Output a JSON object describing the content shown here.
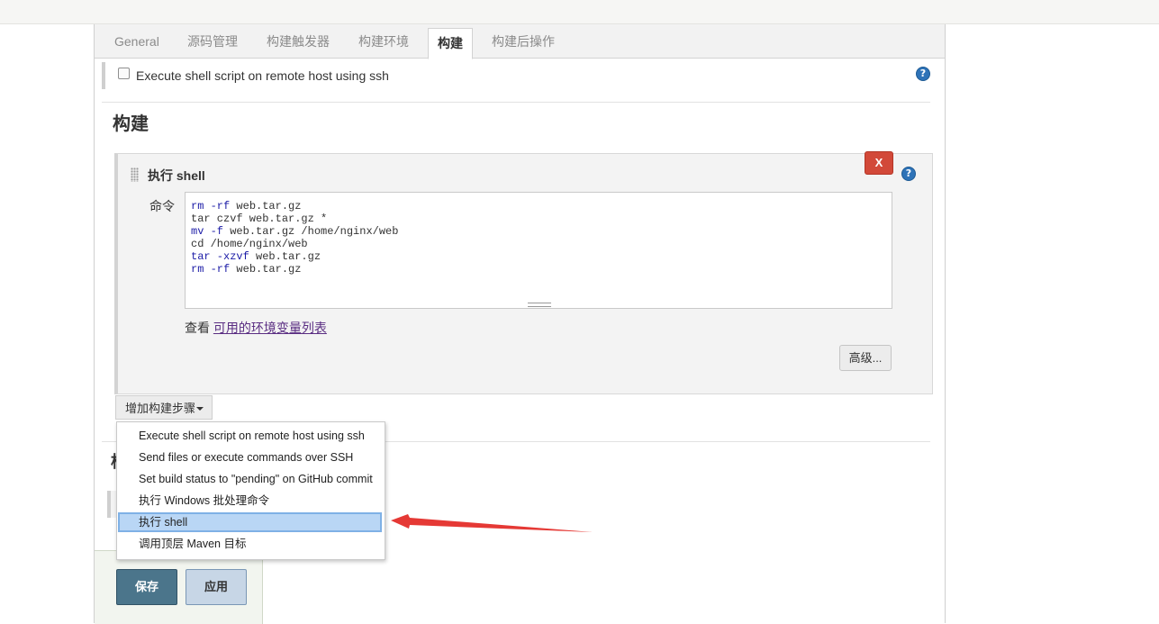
{
  "tabs": [
    "General",
    "源码管理",
    "构建触发器",
    "构建环境",
    "构建",
    "构建后操作"
  ],
  "ssh_option": {
    "label": "Execute shell script on remote host using ssh",
    "checked": false
  },
  "section_title": "构建",
  "build_step": {
    "title": "执行 shell",
    "delete_label": "X",
    "command_label": "命令",
    "command_lines": [
      {
        "kw": "rm -rf",
        "rest": " web.tar.gz"
      },
      {
        "kw": "",
        "rest": "tar czvf web.tar.gz *"
      },
      {
        "kw": "mv -f",
        "rest": " web.tar.gz /home/nginx/web"
      },
      {
        "kw": "",
        "rest": "cd /home/nginx/web"
      },
      {
        "kw": "tar -xzvf",
        "rest": " web.tar.gz"
      },
      {
        "kw": "rm -rf",
        "rest": " web.tar.gz"
      }
    ],
    "see_prefix": "查看 ",
    "see_link": "可用的环境变量列表",
    "advanced_label": "高级..."
  },
  "add_step_label": "增加构建步骤",
  "hidden_section_title": "构",
  "dropdown": {
    "items": [
      "Execute shell script on remote host using ssh",
      "Send files or execute commands over SSH",
      "Set build status to \"pending\" on GitHub commit",
      "执行 Windows 批处理命令",
      "执行 shell",
      "调用顶层 Maven 目标"
    ],
    "selected_index": 4
  },
  "buttons": {
    "save": "保存",
    "apply": "应用"
  },
  "help_glyph": "?",
  "colors": {
    "delete": "#d24939",
    "save": "#4b758b",
    "apply": "#c7d6e6",
    "selected": "#b9d6f5",
    "arrow": "#e53935",
    "help": "#2e73b8"
  }
}
